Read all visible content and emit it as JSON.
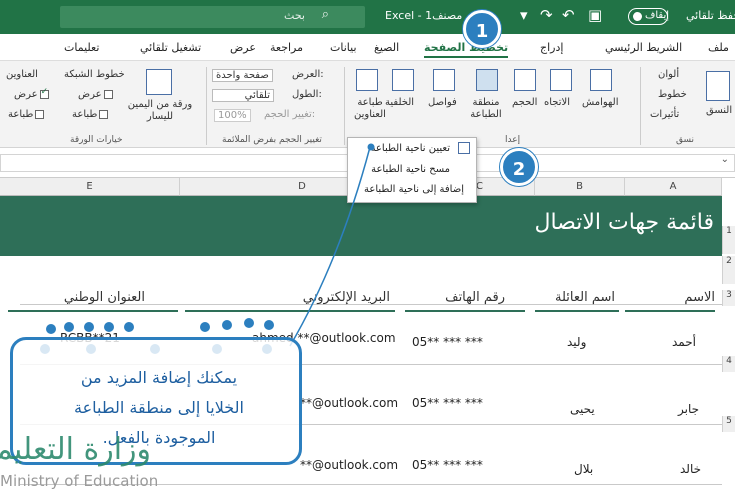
{
  "titlebar": {
    "autosave_label": "حفظ تلقائي",
    "autosave_state": "إيقاف",
    "app_title": "Excel - 1مصنف",
    "search_placeholder": "بحث",
    "accent": "#217346"
  },
  "tabs": [
    "ملف",
    "الشريط الرئيسي",
    "إدراج",
    "تخطيط الصفحة",
    "الصيغ",
    "بيانات",
    "مراجعة",
    "عرض",
    "تشغيل تلقائي",
    "تعليمات"
  ],
  "active_tab": "تخطيط الصفحة",
  "ribbon": {
    "themes": {
      "themes": "النسق",
      "colors": "ألوان",
      "fonts": "خطوط",
      "effects": "تأثيرات",
      "group": "نسق"
    },
    "page_setup": {
      "margins": "الهوامش",
      "orientation": "الاتجاه",
      "size": "الحجم",
      "print_area": "منطقة الطباعة",
      "breaks": "فواصل",
      "background": "الخلفية",
      "print_titles": "طباعة العناوين",
      "group": "إعدا"
    },
    "scale": {
      "width_label": "العرض:",
      "width_value": "صفحة واحدة",
      "height_label": "الطول:",
      "height_value": "تلقائي",
      "scale_label": "تغيير الحجم:",
      "scale_value": "100%",
      "group": "تغيير الحجم بفرض الملائمة"
    },
    "sheet_options": {
      "view_ltr": "ورقة من اليمين لليسار",
      "gridlines": "خطوط الشبكة",
      "headings": "العناوين",
      "view": "عرض",
      "print": "طباعة",
      "group": "خيارات الورقة"
    }
  },
  "dropdown": {
    "items": [
      "تعيين ناحية الطباعة",
      "مسح ناحية الطباعة",
      "إضافة إلى ناحية الطباعة"
    ]
  },
  "columns": [
    "A",
    "B",
    "C",
    "D",
    "E"
  ],
  "rows": [
    "1",
    "2",
    "3",
    "4",
    "5"
  ],
  "sheet": {
    "title": "قائمة جهات الاتصال",
    "headers": [
      "الاسم",
      "اسم العائلة",
      "رقم الهاتف",
      "البريد الإلكتروني",
      "العنوان الوطني"
    ],
    "rows": [
      [
        "أحمد",
        "وليد",
        "05** *** ***",
        "ahmed.**@outlook.com",
        "RCBB**21"
      ],
      [
        "جابر",
        "يحيى",
        "05** *** ***",
        "**@outlook.com",
        ""
      ],
      [
        "خالد",
        "بلال",
        "05** *** ***",
        "**@outlook.com",
        ""
      ]
    ]
  },
  "markers": [
    "1",
    "2"
  ],
  "callout": {
    "line1": "يمكنك إضافة المزيد من",
    "line2": "الخلايا إلى منطقة الطباعة",
    "line3": "الموجودة بالفعل."
  },
  "watermark": {
    "ar": "وزارة التعليم",
    "en": "Ministry of Education"
  },
  "colors": {
    "banner": "#2e6f58",
    "marker": "#2c7fbf"
  }
}
